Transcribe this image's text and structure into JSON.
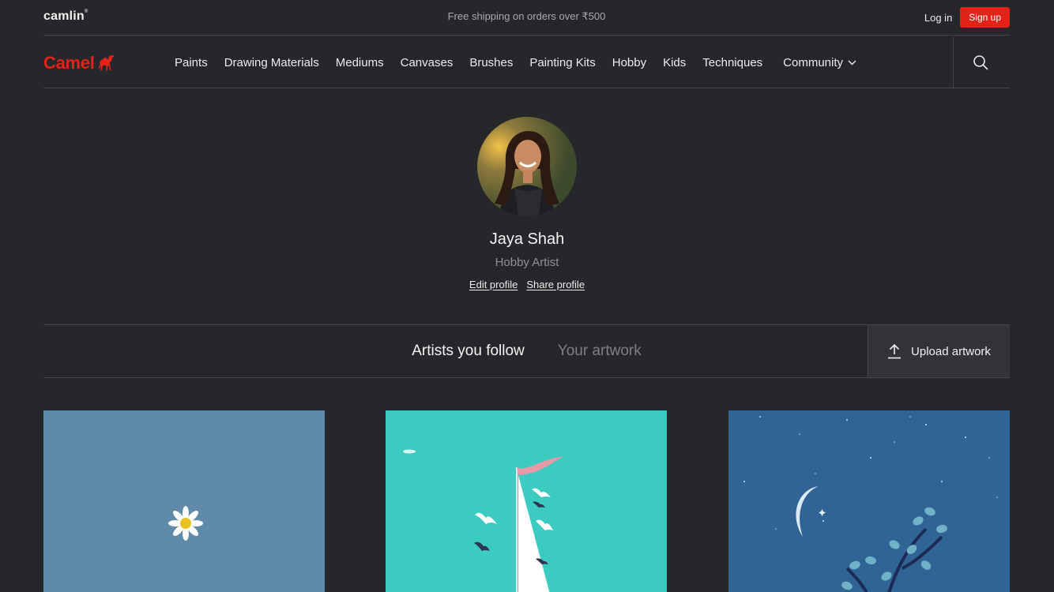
{
  "topbar": {
    "brand": "camlin",
    "promo": "Free shipping on orders over ₹500",
    "login_label": "Log in",
    "signup_label": "Sign up"
  },
  "navbar": {
    "logo_text": "Camel",
    "items": [
      "Paints",
      "Drawing Materials",
      "Mediums",
      "Canvases",
      "Brushes",
      "Painting Kits",
      "Hobby",
      "Kids",
      "Techniques"
    ],
    "community_label": "Community",
    "search_icon": "search-icon"
  },
  "profile": {
    "name": "Jaya Shah",
    "role": "Hobby Artist",
    "edit_label": "Edit profile",
    "share_label": "Share profile"
  },
  "tabs": {
    "active": "Artists you follow",
    "inactive": "Your artwork",
    "upload_label": "Upload artwork"
  },
  "colors": {
    "accent": "#e2231a",
    "background": "#26272b"
  }
}
